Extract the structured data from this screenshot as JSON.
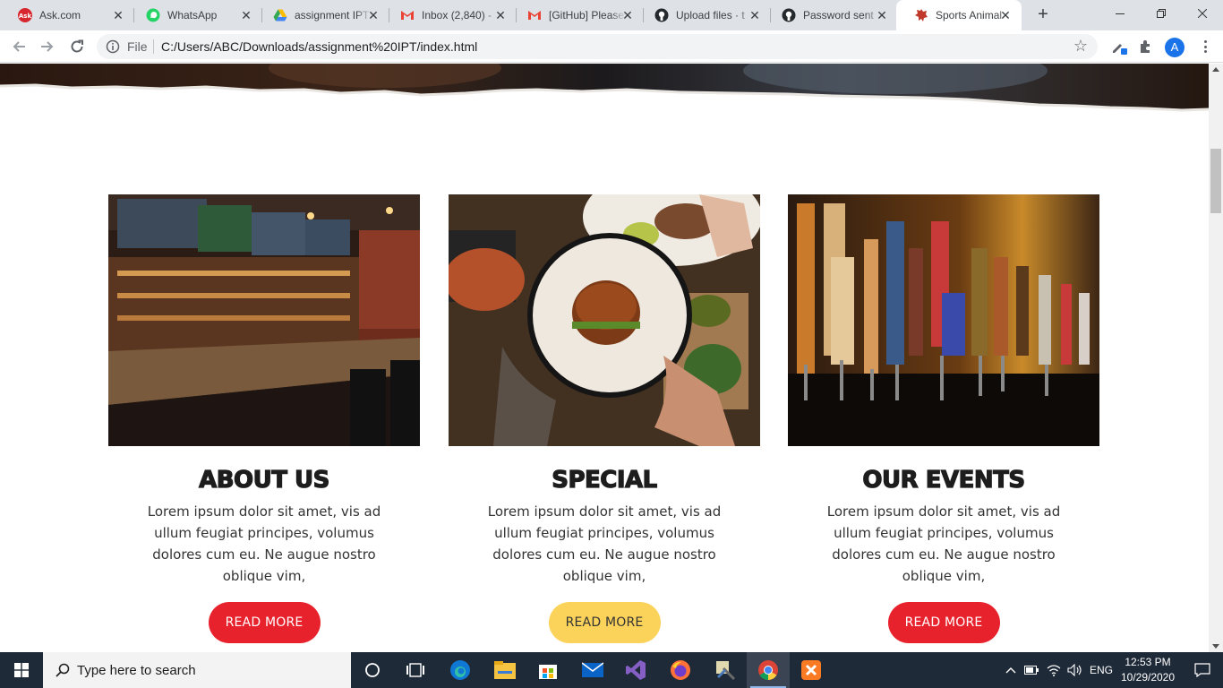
{
  "browser": {
    "tabs": [
      {
        "title": "Ask.com",
        "icon": "ask-icon"
      },
      {
        "title": "WhatsApp",
        "icon": "whatsapp-icon"
      },
      {
        "title": "assignment IPT",
        "icon": "google-drive-icon"
      },
      {
        "title": "Inbox (2,840) -",
        "icon": "gmail-icon"
      },
      {
        "title": "[GitHub] Please",
        "icon": "gmail-icon"
      },
      {
        "title": "Upload files · t",
        "icon": "github-icon"
      },
      {
        "title": "Password sent",
        "icon": "github-icon"
      },
      {
        "title": "Sports Animal",
        "icon": "sports-animal-icon",
        "active": true
      }
    ],
    "address": {
      "scheme_label": "File",
      "url": "C:/Users/ABC/Downloads/assignment%20IPT/index.html"
    },
    "profile_initial": "A"
  },
  "page": {
    "cards": [
      {
        "title": "About Us",
        "text": "Lorem ipsum dolor sit amet, vis ad ullum feugiat principes, volumus dolores cum eu. Ne augue nostro oblique vim,",
        "button": "READ MORE",
        "button_color": "#e8222d"
      },
      {
        "title": "Special",
        "text": "Lorem ipsum dolor sit amet, vis ad ullum feugiat principes, volumus dolores cum eu. Ne augue nostro oblique vim,",
        "button": "READ MORE",
        "button_color": "#fbd35b"
      },
      {
        "title": "Our Events",
        "text": "Lorem ipsum dolor sit amet, vis ad ullum feugiat principes, volumus dolores cum eu. Ne augue nostro oblique vim,",
        "button": "READ MORE",
        "button_color": "#e8222d"
      }
    ]
  },
  "taskbar": {
    "search_placeholder": "Type here to search",
    "language": "ENG",
    "time": "12:53 PM",
    "date": "10/29/2020"
  }
}
